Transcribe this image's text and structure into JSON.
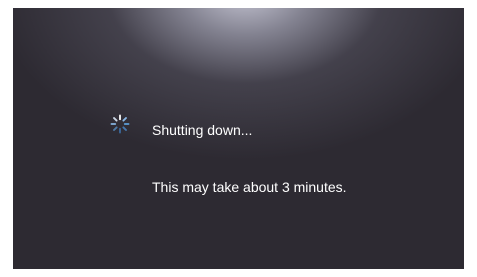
{
  "shutdown_screen": {
    "status": "Shutting down...",
    "message": "This may take about 3 minutes.",
    "spinner_icon": "loading-spinner-icon"
  },
  "colors": {
    "background": "#2d2a32",
    "glow": "#cecedc",
    "text": "#ffffff",
    "spinner_accent": "#5b9bd5"
  }
}
